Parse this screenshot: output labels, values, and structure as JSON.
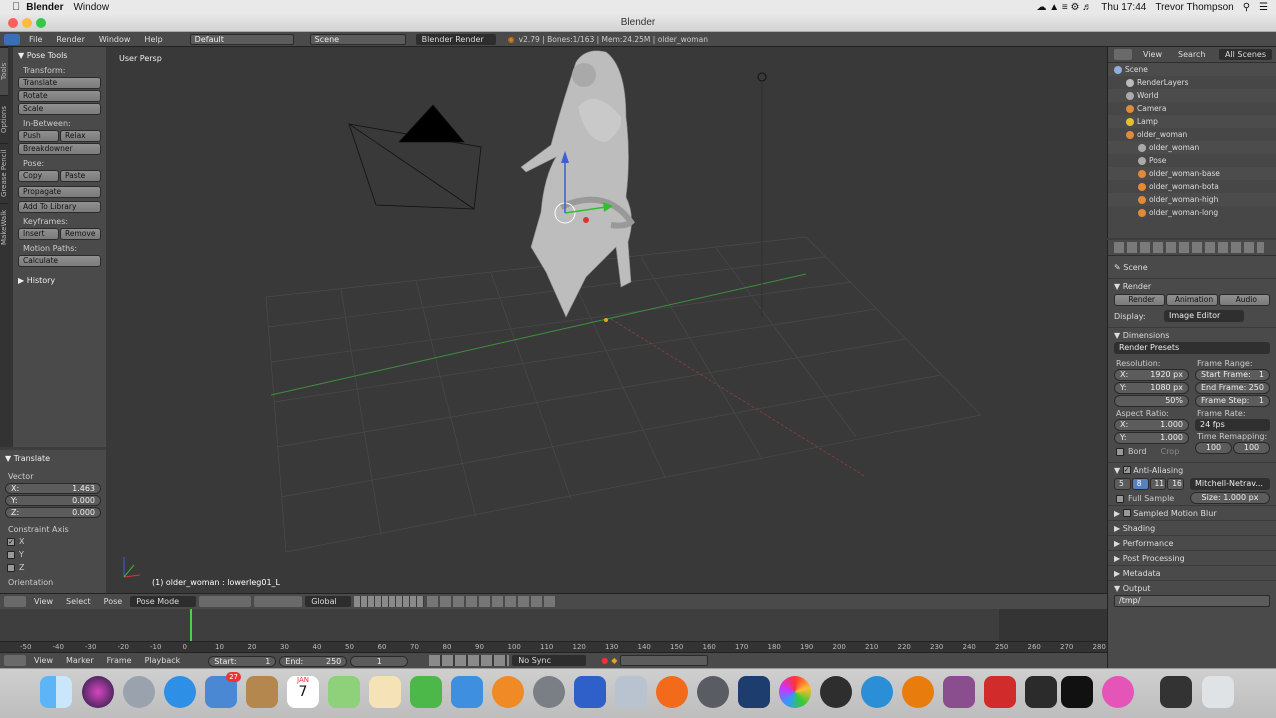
{
  "menubar": {
    "apple": "",
    "app": "Blender",
    "items": [
      "Window"
    ],
    "clock": "Thu 17:44",
    "user": "Trevor Thompson"
  },
  "window": {
    "title": "Blender"
  },
  "info": {
    "menus": [
      "File",
      "Render",
      "Window",
      "Help"
    ],
    "layout": "Default",
    "scene": "Scene",
    "engine": "Blender Render",
    "stats": "v2.79 | Bones:1/163 | Mem:24.25M | older_woman"
  },
  "sidetabs": [
    "Tools",
    "Options",
    "Grease Pencil",
    "MakeWalk"
  ],
  "tools": {
    "header": "Pose Tools",
    "transform": "Transform:",
    "translate": "Translate",
    "rotate": "Rotate",
    "scale": "Scale",
    "inbetween": "In-Between:",
    "push": "Push",
    "relax": "Relax",
    "breakdowner": "Breakdowner",
    "pose": "Pose:",
    "copy": "Copy",
    "paste": "Paste",
    "propagate": "Propagate",
    "addlib": "Add To Library",
    "keyframes": "Keyframes:",
    "insert": "Insert",
    "remove": "Remove",
    "motionpaths": "Motion Paths:",
    "calculate": "Calculate",
    "history": "History"
  },
  "redo": {
    "header": "Translate",
    "vector": "Vector",
    "x": "X:",
    "xv": "1.463",
    "y": "Y:",
    "yv": "0.000",
    "z": "Z:",
    "zv": "0.000",
    "constraint": "Constraint Axis",
    "cx": "X",
    "cy": "Y",
    "cz": "Z",
    "orientation": "Orientation"
  },
  "viewport": {
    "label": "User Persp",
    "status": "(1) older_woman : lowerleg01_L"
  },
  "vphdr": {
    "menus": [
      "View",
      "Select",
      "Pose"
    ],
    "mode": "Pose Mode",
    "orient": "Global"
  },
  "timeline": {
    "ticks": [
      "-50",
      "-40",
      "-30",
      "-20",
      "-10",
      "0",
      "10",
      "20",
      "30",
      "40",
      "50",
      "60",
      "70",
      "80",
      "90",
      "100",
      "110",
      "120",
      "130",
      "140",
      "150",
      "160",
      "170",
      "180",
      "190",
      "200",
      "210",
      "220",
      "230",
      "240",
      "250",
      "260",
      "270",
      "280"
    ],
    "menus": [
      "View",
      "Marker",
      "Frame",
      "Playback"
    ],
    "start": "Start:",
    "startv": "1",
    "end": "End:",
    "endv": "250",
    "current": "1",
    "sync": "No Sync"
  },
  "outliner": {
    "menus": [
      "View",
      "Search",
      "All Scenes"
    ],
    "items": [
      "Scene",
      "RenderLayers",
      "World",
      "Camera",
      "Lamp",
      "older_woman",
      "older_woman",
      "Pose",
      "older_woman-base",
      "older_woman-bota",
      "older_woman-high",
      "older_woman-long"
    ]
  },
  "props": {
    "scene": "Scene",
    "render": "Render",
    "render_btn": "Render",
    "anim_btn": "Animation",
    "audio_btn": "Audio",
    "display": "Display:",
    "display_v": "Image Editor",
    "dimensions": "Dimensions",
    "presets": "Render Presets",
    "resolution": "Resolution:",
    "rx": "X:",
    "rxv": "1920 px",
    "ry": "Y:",
    "ryv": "1080 px",
    "rpct": "50%",
    "framerange": "Frame Range:",
    "sf": "Start Frame:",
    "sfv": "1",
    "ef": "End Frame:",
    "efv": "250",
    "fs": "Frame Step:",
    "fsv": "1",
    "aspect": "Aspect Ratio:",
    "ax": "X:",
    "axv": "1.000",
    "ay": "Y:",
    "ayv": "1.000",
    "framerate": "Frame Rate:",
    "fps": "24 fps",
    "remap": "Time Remapping:",
    "r1": "100",
    "r2": "100",
    "bord": "Bord",
    "crop": "Crop",
    "aa": "Anti-Aliasing",
    "aa5": "5",
    "aa8": "8",
    "aa11": "11",
    "aa16": "16",
    "filter": "Mitchell-Netrav...",
    "fullsample": "Full Sample",
    "size": "Size: 1.000 px",
    "smb": "Sampled Motion Blur",
    "shading": "Shading",
    "performance": "Performance",
    "postproc": "Post Processing",
    "metadata": "Metadata",
    "output": "Output",
    "outpath": "/tmp/"
  },
  "dock": {
    "badge_mail": "27",
    "cal_month": "JAN",
    "cal_day": "7"
  },
  "colors": {
    "accent": "#5680c2",
    "header": "#4a4a4a",
    "viewport": "#393939"
  }
}
